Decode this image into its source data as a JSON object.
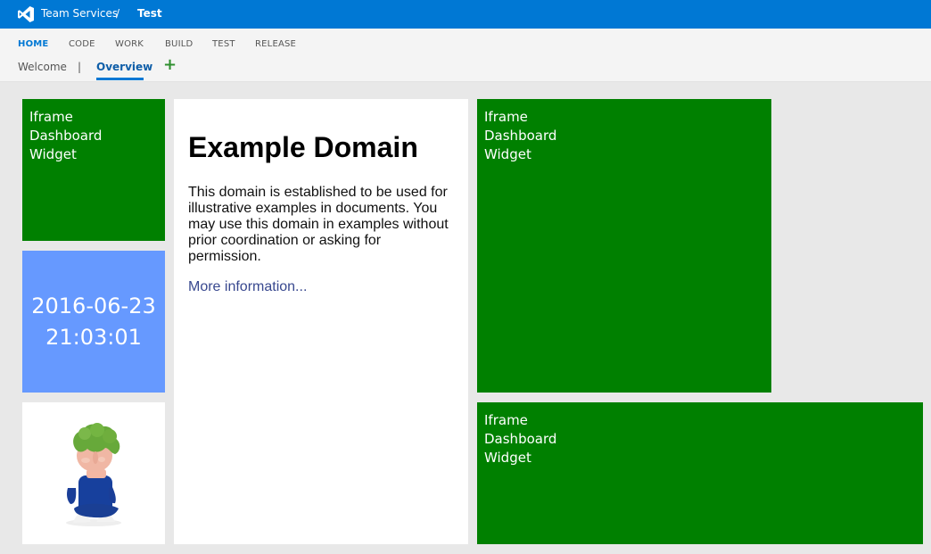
{
  "topbar": {
    "product": "Team Services",
    "separator": "/",
    "project": "Test",
    "logo_icon": "visual-studio-icon"
  },
  "hubs": [
    {
      "label": "HOME",
      "active": true
    },
    {
      "label": "CODE",
      "active": false
    },
    {
      "label": "WORK",
      "active": false
    },
    {
      "label": "BUILD",
      "active": false
    },
    {
      "label": "TEST",
      "active": false
    },
    {
      "label": "RELEASE",
      "active": false
    }
  ],
  "subnav": {
    "welcome": "Welcome",
    "pipe": "|",
    "overview": "Overview",
    "add_icon": "plus-icon"
  },
  "widgets": {
    "iframe_title": [
      "Iframe",
      "Dashboard",
      "Widget"
    ],
    "clock": {
      "date": "2016-06-23",
      "time": "21:03:01"
    },
    "example": {
      "title": "Example Domain",
      "body": "This domain is established to be used for illustrative examples in documents. You may use this domain in examples without prior coordination or asking for permission.",
      "link": "More information..."
    }
  },
  "colors": {
    "accent": "#0078d4",
    "tile_green": "#008000",
    "tile_blue": "#6699ff"
  }
}
